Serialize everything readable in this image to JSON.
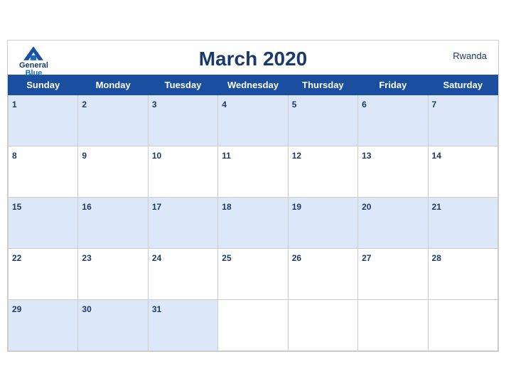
{
  "header": {
    "title": "March 2020",
    "country": "Rwanda",
    "logo": {
      "general": "General",
      "blue": "Blue"
    }
  },
  "weekdays": [
    "Sunday",
    "Monday",
    "Tuesday",
    "Wednesday",
    "Thursday",
    "Friday",
    "Saturday"
  ],
  "weeks": [
    [
      1,
      2,
      3,
      4,
      5,
      6,
      7
    ],
    [
      8,
      9,
      10,
      11,
      12,
      13,
      14
    ],
    [
      15,
      16,
      17,
      18,
      19,
      20,
      21
    ],
    [
      22,
      23,
      24,
      25,
      26,
      27,
      28
    ],
    [
      29,
      30,
      31,
      null,
      null,
      null,
      null
    ]
  ]
}
